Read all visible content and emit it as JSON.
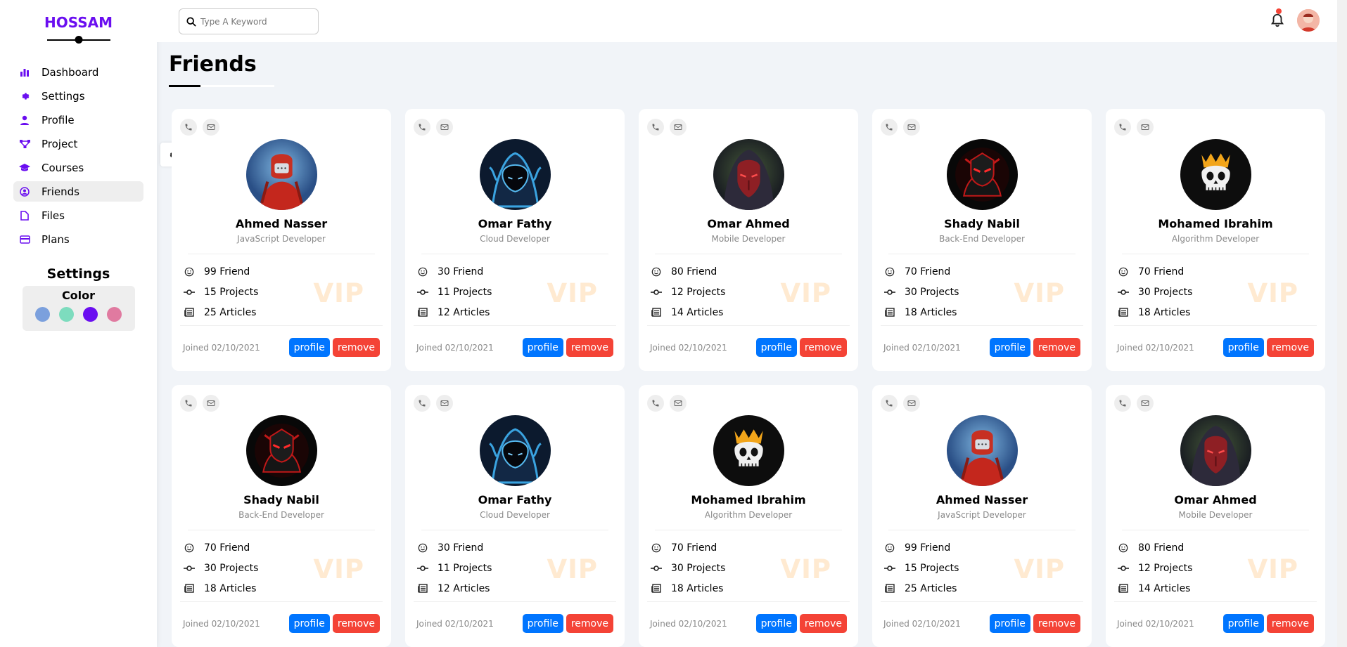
{
  "brand": "HOSSAM",
  "nav": [
    {
      "label": "Dashboard",
      "icon": "chart-bar-icon"
    },
    {
      "label": "Settings",
      "icon": "gear-icon"
    },
    {
      "label": "Profile",
      "icon": "user-icon"
    },
    {
      "label": "Project",
      "icon": "diagram-icon"
    },
    {
      "label": "Courses",
      "icon": "graduation-cap-icon"
    },
    {
      "label": "Friends",
      "icon": "user-circle-icon",
      "active": true
    },
    {
      "label": "Files",
      "icon": "file-icon"
    },
    {
      "label": "Plans",
      "icon": "credit-card-icon"
    }
  ],
  "side_settings": {
    "title": "Settings",
    "color_label": "Color",
    "colors": [
      "#7ba0dd",
      "#7ddcbe",
      "#6a0ef0",
      "#e07aa0"
    ]
  },
  "search": {
    "placeholder": "Type A Keyword"
  },
  "page_title": "Friends",
  "accent_color": "#6a0ef0",
  "cards": [
    {
      "name": "Ahmed Nasser",
      "job": "JavaScript Developer",
      "friends": "99 Friend",
      "projects": "15 Projects",
      "articles": "25 Articles",
      "joined": "Joined 02/10/2021",
      "badge": "VIP",
      "profile_label": "profile",
      "remove_label": "remove",
      "avatar": "red-armor-avatar"
    },
    {
      "name": "Omar Fathy",
      "job": "Cloud Developer",
      "friends": "30 Friend",
      "projects": "11 Projects",
      "articles": "12 Articles",
      "joined": "Joined 02/10/2021",
      "badge": "VIP",
      "profile_label": "profile",
      "remove_label": "remove",
      "avatar": "blue-hood-avatar"
    },
    {
      "name": "Omar Ahmed",
      "job": "Mobile Developer",
      "friends": "80 Friend",
      "projects": "12 Projects",
      "articles": "14 Articles",
      "joined": "Joined 02/10/2021",
      "badge": "VIP",
      "profile_label": "profile",
      "remove_label": "remove",
      "avatar": "dark-mask-avatar"
    },
    {
      "name": "Shady Nabil",
      "job": "Back-End Developer",
      "friends": "70 Friend",
      "projects": "30 Projects",
      "articles": "18 Articles",
      "joined": "Joined 02/10/2021",
      "badge": "VIP",
      "profile_label": "profile",
      "remove_label": "remove",
      "avatar": "red-ninja-avatar"
    },
    {
      "name": "Mohamed Ibrahim",
      "job": "Algorithm Developer",
      "friends": "70 Friend",
      "projects": "30 Projects",
      "articles": "18 Articles",
      "joined": "Joined 02/10/2021",
      "badge": "VIP",
      "profile_label": "profile",
      "remove_label": "remove",
      "avatar": "skull-crown-avatar"
    },
    {
      "name": "Shady Nabil",
      "job": "Back-End Developer",
      "friends": "70 Friend",
      "projects": "30 Projects",
      "articles": "18 Articles",
      "joined": "Joined 02/10/2021",
      "badge": "VIP",
      "profile_label": "profile",
      "remove_label": "remove",
      "avatar": "red-ninja-avatar"
    },
    {
      "name": "Omar Fathy",
      "job": "Cloud Developer",
      "friends": "30 Friend",
      "projects": "11 Projects",
      "articles": "12 Articles",
      "joined": "Joined 02/10/2021",
      "badge": "VIP",
      "profile_label": "profile",
      "remove_label": "remove",
      "avatar": "blue-hood-avatar"
    },
    {
      "name": "Mohamed Ibrahim",
      "job": "Algorithm Developer",
      "friends": "70 Friend",
      "projects": "30 Projects",
      "articles": "18 Articles",
      "joined": "Joined 02/10/2021",
      "badge": "VIP",
      "profile_label": "profile",
      "remove_label": "remove",
      "avatar": "skull-crown-avatar"
    },
    {
      "name": "Ahmed Nasser",
      "job": "JavaScript Developer",
      "friends": "99 Friend",
      "projects": "15 Projects",
      "articles": "25 Articles",
      "joined": "Joined 02/10/2021",
      "badge": "VIP",
      "profile_label": "profile",
      "remove_label": "remove",
      "avatar": "red-armor-avatar"
    },
    {
      "name": "Omar Ahmed",
      "job": "Mobile Developer",
      "friends": "80 Friend",
      "projects": "12 Projects",
      "articles": "14 Articles",
      "joined": "Joined 02/10/2021",
      "badge": "VIP",
      "profile_label": "profile",
      "remove_label": "remove",
      "avatar": "dark-mask-avatar"
    }
  ]
}
